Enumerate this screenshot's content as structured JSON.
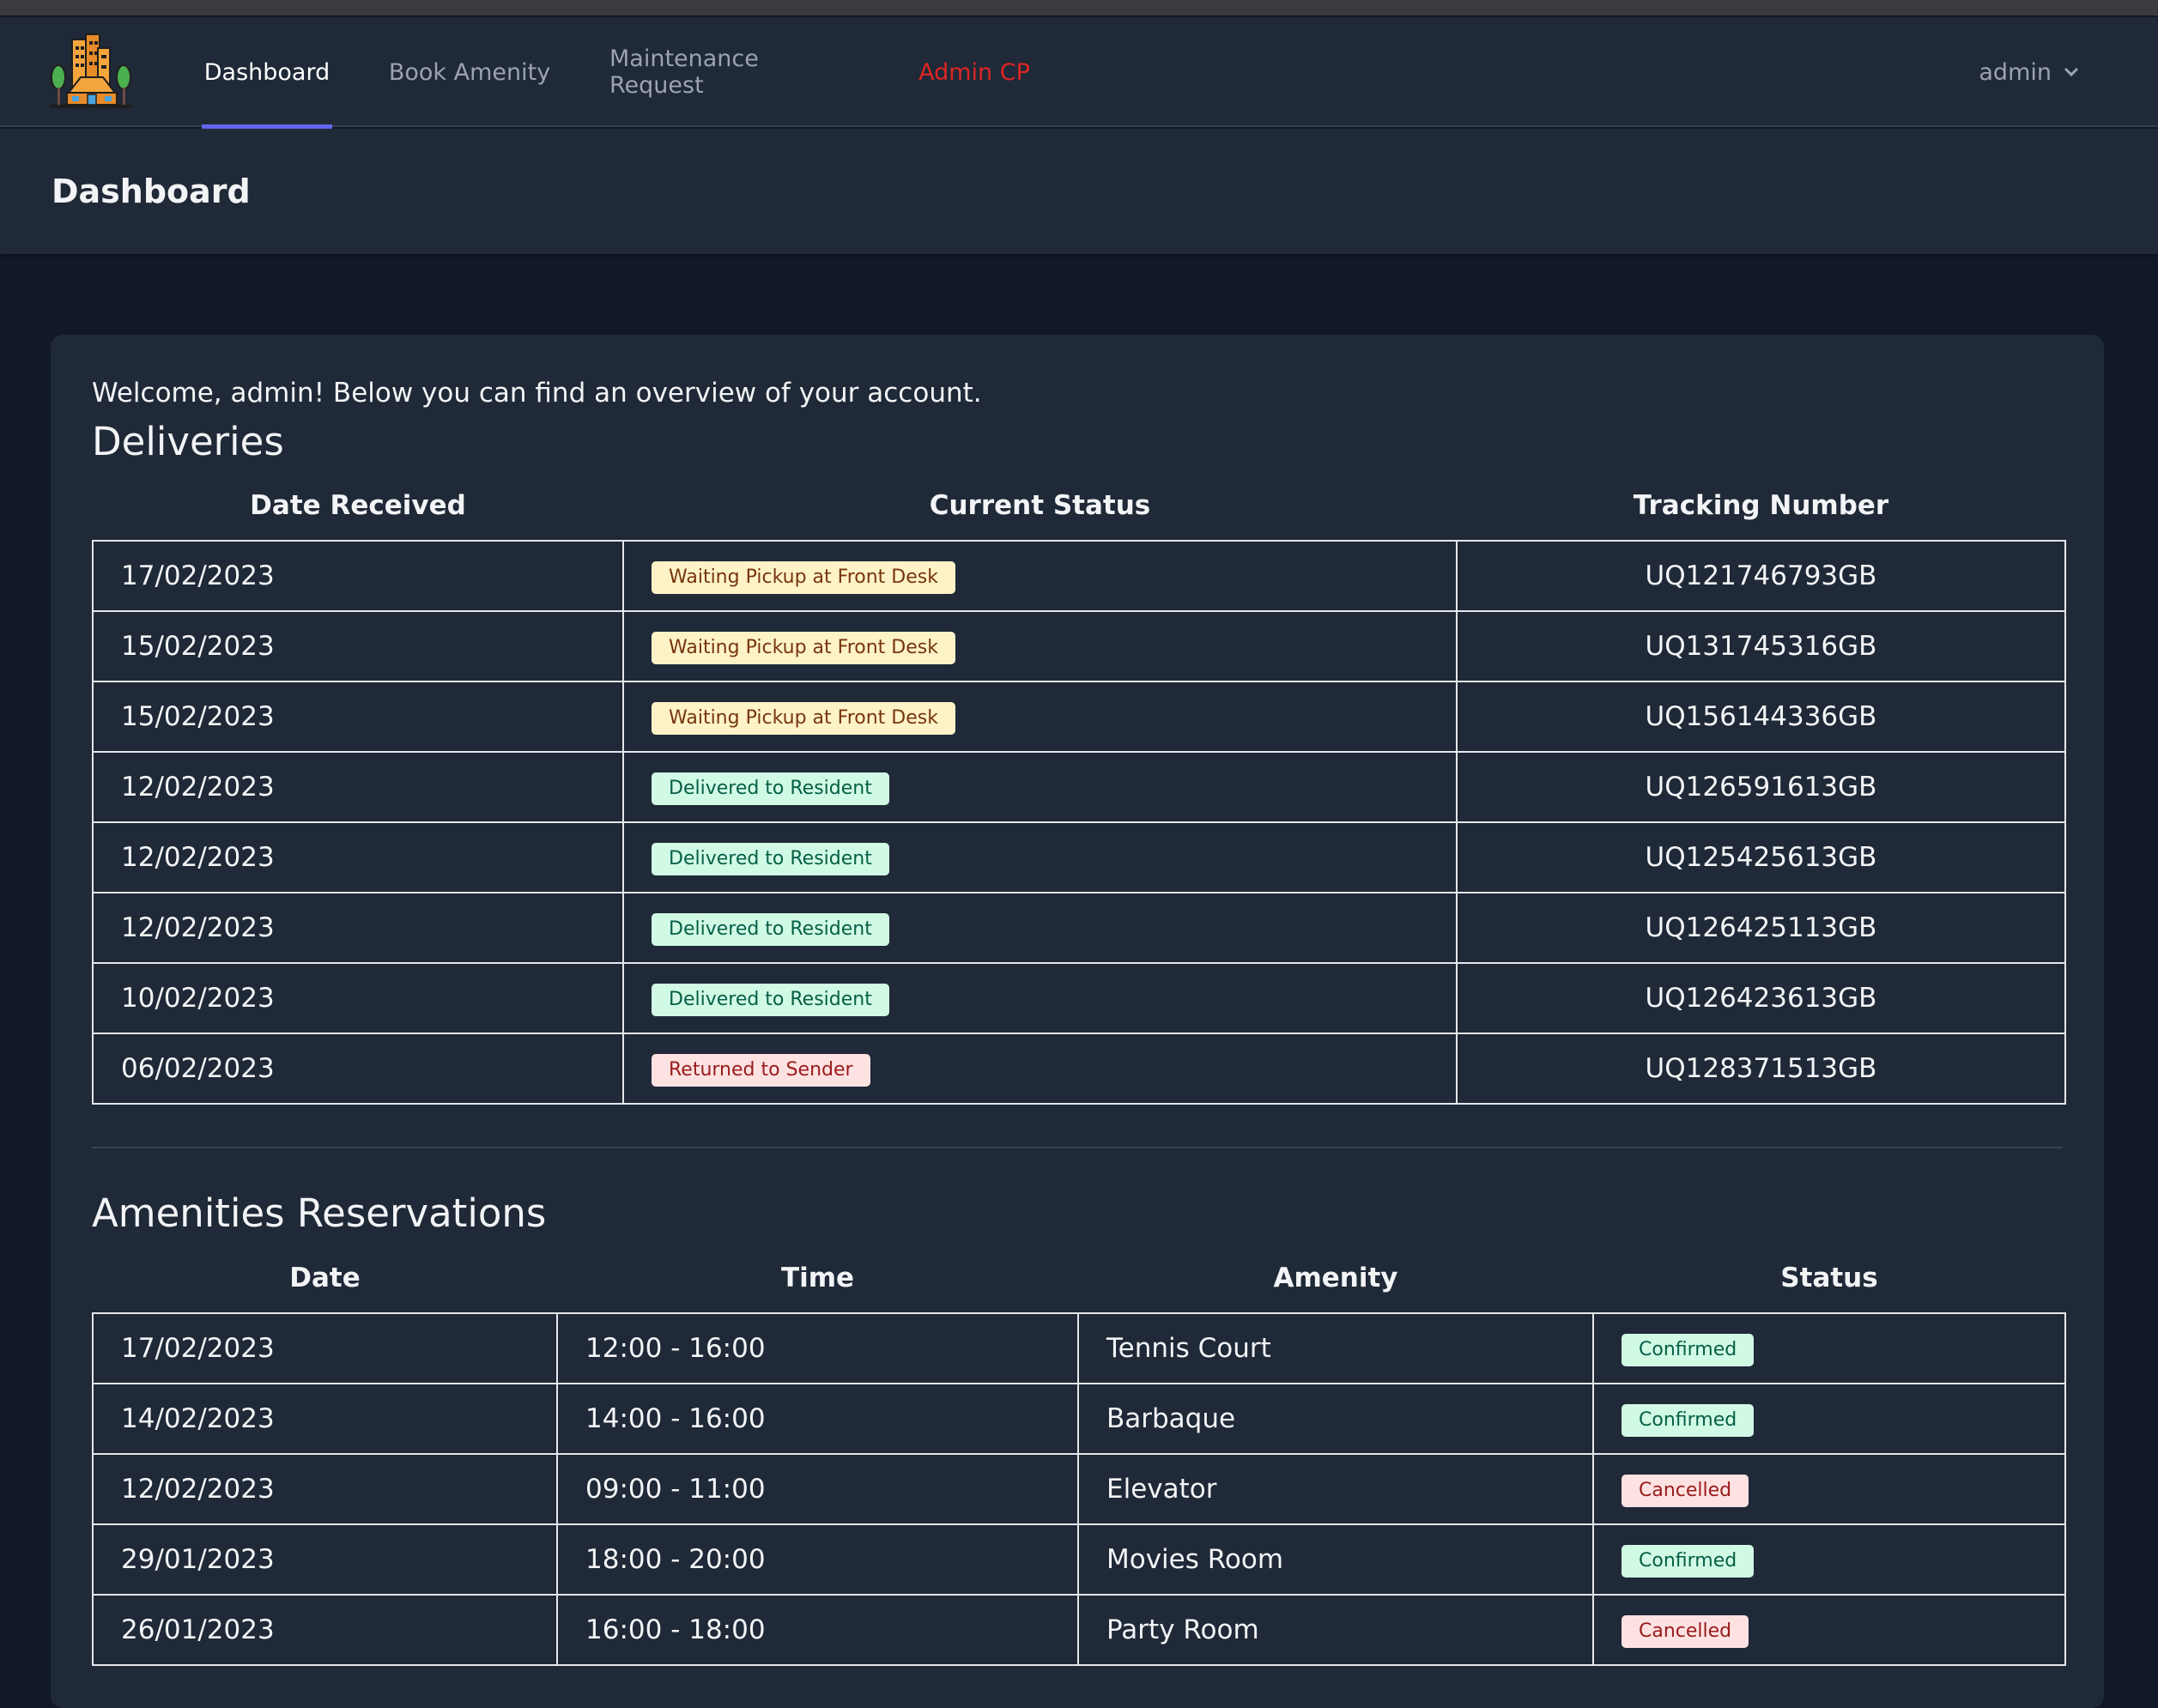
{
  "nav": {
    "items": [
      {
        "label": "Dashboard"
      },
      {
        "label": "Book Amenity"
      },
      {
        "label": "Maintenance Request"
      },
      {
        "label": "Admin CP"
      }
    ],
    "user": "admin"
  },
  "header": {
    "title": "Dashboard"
  },
  "welcome": "Welcome, admin! Below you can find an overview of your account.",
  "deliveries": {
    "title": "Deliveries",
    "columns": [
      "Date Received",
      "Current Status",
      "Tracking Number"
    ],
    "rows": [
      {
        "date": "17/02/2023",
        "status": "Waiting Pickup at Front Desk",
        "tracking": "UQ121746793GB"
      },
      {
        "date": "15/02/2023",
        "status": "Waiting Pickup at Front Desk",
        "tracking": "UQ131745316GB"
      },
      {
        "date": "15/02/2023",
        "status": "Waiting Pickup at Front Desk",
        "tracking": "UQ156144336GB"
      },
      {
        "date": "12/02/2023",
        "status": "Delivered to Resident",
        "tracking": "UQ126591613GB"
      },
      {
        "date": "12/02/2023",
        "status": "Delivered to Resident",
        "tracking": "UQ125425613GB"
      },
      {
        "date": "12/02/2023",
        "status": "Delivered to Resident",
        "tracking": "UQ126425113GB"
      },
      {
        "date": "10/02/2023",
        "status": "Delivered to Resident",
        "tracking": "UQ126423613GB"
      },
      {
        "date": "06/02/2023",
        "status": "Returned to Sender",
        "tracking": "UQ128371513GB"
      }
    ]
  },
  "reservations": {
    "title": "Amenities Reservations",
    "columns": [
      "Date",
      "Time",
      "Amenity",
      "Status"
    ],
    "rows": [
      {
        "date": "17/02/2023",
        "time": "12:00 - 16:00",
        "amenity": "Tennis Court",
        "status": "Confirmed"
      },
      {
        "date": "14/02/2023",
        "time": "14:00 - 16:00",
        "amenity": "Barbaque",
        "status": "Confirmed"
      },
      {
        "date": "12/02/2023",
        "time": "09:00 - 11:00",
        "amenity": "Elevator",
        "status": "Cancelled"
      },
      {
        "date": "29/01/2023",
        "time": "18:00 - 20:00",
        "amenity": "Movies Room",
        "status": "Confirmed"
      },
      {
        "date": "26/01/2023",
        "time": "16:00 - 18:00",
        "amenity": "Party Room",
        "status": "Cancelled"
      }
    ]
  },
  "colors": {
    "accent": "#6366f1",
    "admin_link": "#dc2626",
    "waiting_badge": "#fef3c7",
    "delivered_badge": "#d1fae5",
    "returned_badge": "#fee2e2"
  }
}
